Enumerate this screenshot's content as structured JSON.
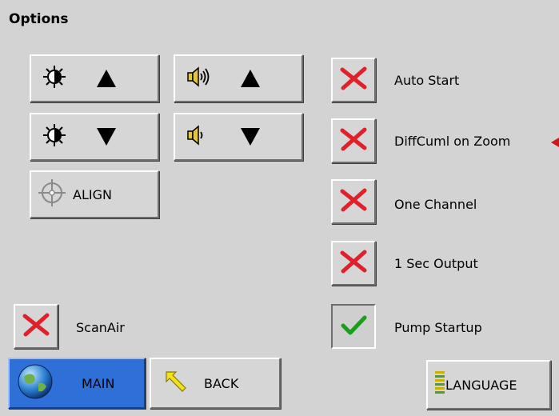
{
  "title": "Options",
  "controls": {
    "brightness_up": "brightness-up",
    "volume_up": "volume-up",
    "brightness_down": "brightness-down",
    "volume_down": "volume-down",
    "align_label": "ALIGN"
  },
  "options": [
    {
      "label": "Auto Start",
      "checked": false
    },
    {
      "label": "DiffCuml on Zoom",
      "checked": false
    },
    {
      "label": "One Channel",
      "checked": false
    },
    {
      "label": "1 Sec Output",
      "checked": false
    },
    {
      "label": "Pump Startup",
      "checked": true
    }
  ],
  "scanair": {
    "label": "ScanAir",
    "checked": false
  },
  "bottom": {
    "main_label": "MAIN",
    "back_label": "BACK",
    "language_label": "LANGUAGE"
  },
  "colors": {
    "background": "#d3d3d3",
    "main_button": "#2f6fd8",
    "x_mark": "#e0202a",
    "check_mark": "#18a018"
  }
}
